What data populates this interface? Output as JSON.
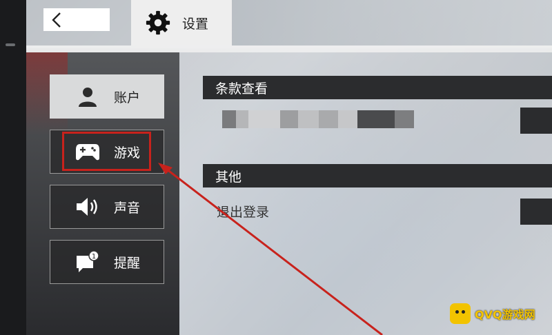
{
  "header": {
    "back_icon": "chevron-left-icon",
    "settings_icon": "gear-icon",
    "title": "设置"
  },
  "sidebar": {
    "items": [
      {
        "label": "账户",
        "icon": "person-icon",
        "active": true
      },
      {
        "label": "游戏",
        "icon": "gamepad-icon",
        "active": false
      },
      {
        "label": "声音",
        "icon": "speaker-icon",
        "active": false
      },
      {
        "label": "提醒",
        "icon": "notification-bubble-icon",
        "active": false,
        "badge": "1"
      }
    ]
  },
  "content": {
    "sections": [
      {
        "title": "条款查看"
      },
      {
        "title": "其他",
        "rows": [
          {
            "label": "退出登录"
          }
        ]
      }
    ]
  },
  "watermark": {
    "text": "QVQ游戏网"
  },
  "colors": {
    "highlight": "#c8221c",
    "section_bg": "#2b2c2e",
    "active_item_bg": "#d9dadb",
    "watermark": "#f2c300"
  }
}
